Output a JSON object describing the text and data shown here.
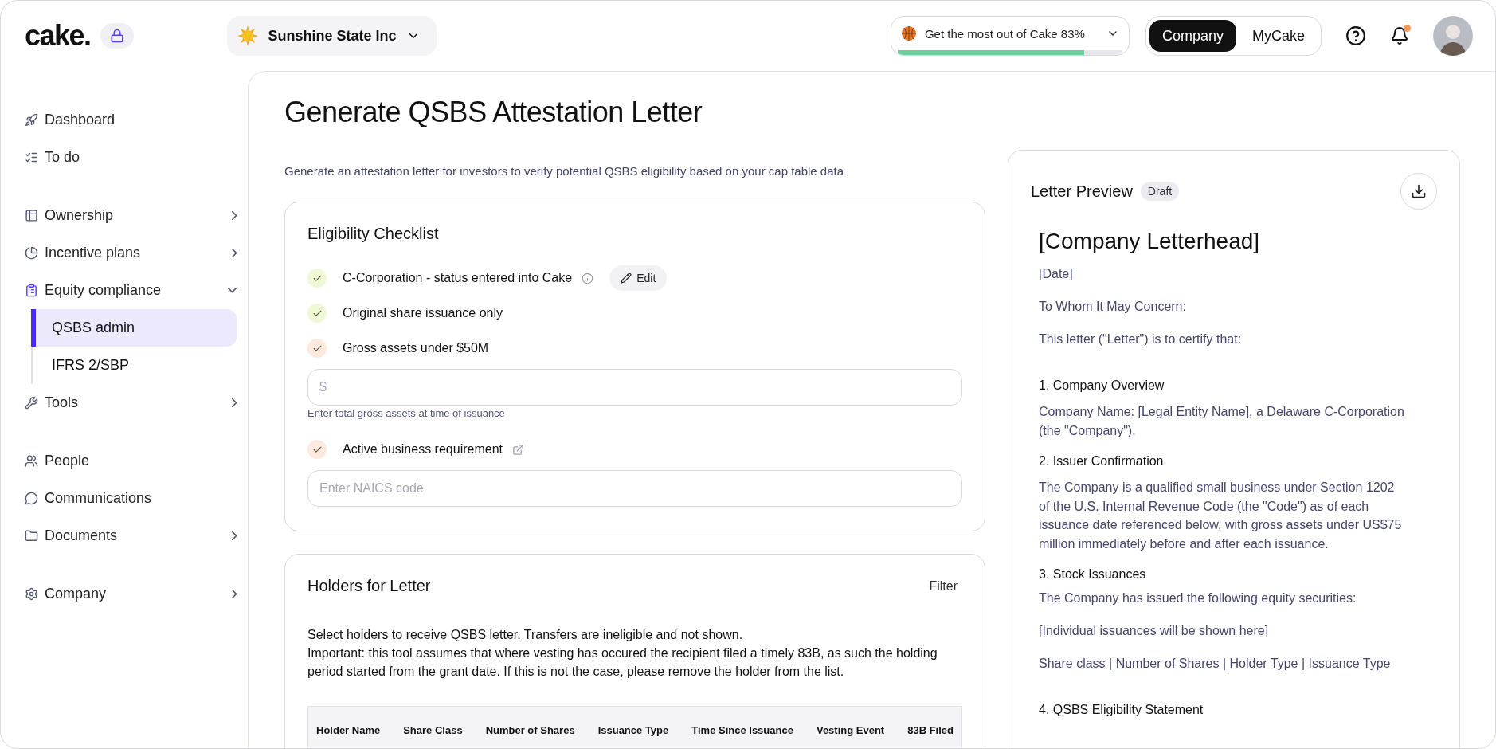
{
  "brand": {
    "logo": "cake."
  },
  "company_selector": {
    "name": "Sunshine State Inc"
  },
  "onboarding": {
    "label": "Get the most out of Cake 83%",
    "level": 0.83
  },
  "mode_toggle": [
    {
      "label": "Company",
      "selected": true
    },
    {
      "label": "MyCake",
      "selected": false
    }
  ],
  "notifications": {
    "unread": true
  },
  "sidebar": {
    "groups": [
      [
        {
          "label": "Dashboard"
        },
        {
          "label": "To do"
        }
      ],
      [
        {
          "label": "Ownership",
          "expanded": false
        },
        {
          "label": "Incentive plans",
          "expanded": false
        },
        {
          "label": "Equity compliance",
          "expanded": true,
          "children": [
            {
              "label": "QSBS admin",
              "selected": true
            },
            {
              "label": "IFRS 2/SBP",
              "selected": false
            }
          ]
        },
        {
          "label": "Tools",
          "expanded": false
        }
      ],
      [
        {
          "label": "People"
        },
        {
          "label": "Communications"
        },
        {
          "label": "Documents",
          "expanded": false
        }
      ],
      [
        {
          "label": "Company",
          "expanded": false
        }
      ]
    ]
  },
  "page": {
    "title": "Generate QSBS Attestation Letter",
    "subtitle": "Generate an attestation letter for investors to verify potential QSBS eligibility based on your cap table data"
  },
  "checklist": {
    "title": "Eligibility Checklist",
    "items": [
      {
        "label": "C-Corporation - status entered into Cake",
        "color": "#eff9d6",
        "kind": "info",
        "button": "Edit"
      },
      {
        "label": "Original share issuance only",
        "color": "#eff9d6",
        "kind": "plain"
      },
      {
        "label": "Gross assets under $50M",
        "color": "#fde9de",
        "kind": "plain",
        "field": {
          "placeholder": "$",
          "hint": "Enter total gross assets at time of issuance"
        }
      },
      {
        "label": "Active business requirement",
        "color": "#fde9de",
        "kind": "link",
        "field": {
          "placeholder": "Enter NAICS code"
        }
      }
    ]
  },
  "holders": {
    "title": "Holders for Letter",
    "filter": "Filter",
    "notes": [
      "Select holders to receive QSBS letter. Transfers are ineligible and not shown.",
      "Important: this tool assumes that where vesting has occured the recipient filed a timely 83B, as such the holding period started from the grant date. If this is not the case, please remove the holder from the list."
    ],
    "table": {
      "columns": [
        "Holder Name",
        "Share Class",
        "Number of Shares",
        "Issuance Type",
        "Time Since Issuance",
        "Vesting Event",
        "83B Filed"
      ]
    }
  },
  "preview": {
    "title": "Letter Preview",
    "badge": "Draft",
    "blocks": [
      {
        "kind": "letterhead",
        "text": "[Company Letterhead]"
      },
      {
        "kind": "para",
        "text": "[Date]"
      },
      {
        "kind": "para",
        "text": "To Whom It May Concern:"
      },
      {
        "kind": "para",
        "text": "This letter (\"Letter\") is to certify that:"
      },
      {
        "kind": "heading",
        "text": "1. Company Overview"
      },
      {
        "kind": "body",
        "text": "Company Name: [Legal Entity Name], a Delaware C-Corporation (the \"Company\")."
      },
      {
        "kind": "heading",
        "text": "2. Issuer Confirmation"
      },
      {
        "kind": "body",
        "text": "The Company is a qualified small business under Section 1202 of the U.S. Internal Revenue Code (the \"Code\") as of each issuance date referenced below, with gross assets under US$75 million immediately before and after each issuance."
      },
      {
        "kind": "heading",
        "text": "3. Stock Issuances"
      },
      {
        "kind": "para",
        "text": "The Company has issued the following equity securities:"
      },
      {
        "kind": "para",
        "text": "[Individual issuances will be shown here]"
      },
      {
        "kind": "para",
        "text": "Share class | Number of Shares | Holder Type | Issuance Type"
      },
      {
        "kind": "heading",
        "text": "4. QSBS Eligibility Statement"
      }
    ]
  }
}
